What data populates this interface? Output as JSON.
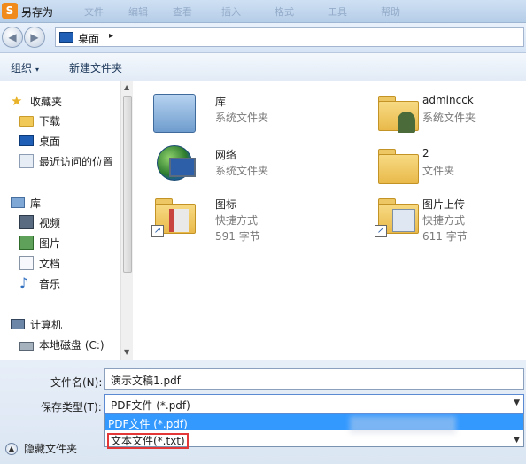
{
  "window": {
    "title": "另存为",
    "app_icon_glyph": "S"
  },
  "ghost_menu": [
    "文件",
    "编辑",
    "查看",
    "插入",
    "格式",
    "工具",
    "帮助"
  ],
  "address": {
    "crumb": "桌面",
    "arrow": "▸"
  },
  "toolbar": {
    "organize": "组织",
    "organize_caret": "▾",
    "new_folder": "新建文件夹"
  },
  "sidebar": {
    "items": [
      {
        "label": "收藏夹",
        "icon": "star-icon"
      },
      {
        "label": "下载",
        "icon": "folder-icon"
      },
      {
        "label": "桌面",
        "icon": "desktop-icon"
      },
      {
        "label": "最近访问的位置",
        "icon": "recent-icon"
      },
      {
        "label": "库",
        "icon": "library-icon"
      },
      {
        "label": "视频",
        "icon": "video-icon"
      },
      {
        "label": "图片",
        "icon": "picture-icon"
      },
      {
        "label": "文档",
        "icon": "document-icon"
      },
      {
        "label": "音乐",
        "icon": "music-icon"
      },
      {
        "label": "计算机",
        "icon": "computer-icon"
      },
      {
        "label": "本地磁盘 (C:)",
        "icon": "disk-icon"
      }
    ]
  },
  "files": [
    {
      "name": "库",
      "line1": "系统文件夹",
      "line2": ""
    },
    {
      "name": "admincck",
      "line1": "系统文件夹",
      "line2": ""
    },
    {
      "name": "网络",
      "line1": "系统文件夹",
      "line2": ""
    },
    {
      "name": "2",
      "line1": "文件夹",
      "line2": ""
    },
    {
      "name": "图标",
      "line1": "快捷方式",
      "line2": "591 字节"
    },
    {
      "name": "图片上传",
      "line1": "快捷方式",
      "line2": "611 字节"
    }
  ],
  "form": {
    "filename_label": "文件名(N):",
    "filename_value": "演示文稿1.pdf",
    "filetype_label": "保存类型(T):",
    "filetype_value": "PDF文件 (*.pdf)",
    "options": [
      "PDF文件 (*.pdf)",
      "文本文件(*.txt)"
    ],
    "hide_folders": "隐藏文件夹"
  },
  "colors": {
    "selection": "#3399ff",
    "highlight_box": "#e33636",
    "titlebar": "#c3d6ee"
  }
}
